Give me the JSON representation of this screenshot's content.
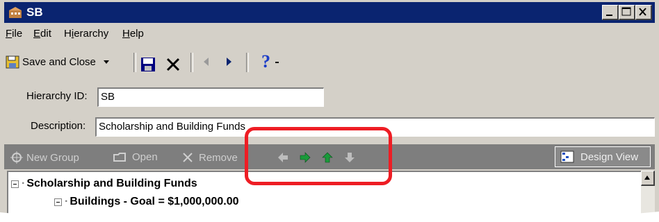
{
  "window": {
    "title": "SB"
  },
  "menu": [
    {
      "label": "File",
      "underline": "F"
    },
    {
      "label": "Edit",
      "underline": "E"
    },
    {
      "label": "Hierarchy",
      "underline": "i"
    },
    {
      "label": "Help",
      "underline": "H"
    }
  ],
  "toolbar": {
    "save_and_close_label": "Save and Close",
    "icons": [
      "save-close-icon",
      "dropdown-arrow-icon",
      "save-icon",
      "delete-icon",
      "previous-icon",
      "next-icon",
      "help-icon"
    ]
  },
  "form": {
    "hierarchy_id_label": "Hierarchy ID:",
    "hierarchy_id_value": "SB",
    "description_label": "Description:",
    "description_value": "Scholarship and Building Funds"
  },
  "group_toolbar": {
    "new_group_label": "New Group",
    "open_label": "Open",
    "remove_label": "Remove",
    "design_view_label": "Design View",
    "arrow_icons": [
      "move-left-icon",
      "move-right-icon",
      "move-up-icon",
      "move-down-icon"
    ]
  },
  "tree": {
    "root_label": "Scholarship and Building Funds",
    "child_label": "Buildings  -  Goal = $1,000,000.00"
  },
  "colors": {
    "titlebar": "#0a2470",
    "highlight": "#ee1d24",
    "arrow_green": "#1a9a3a"
  }
}
